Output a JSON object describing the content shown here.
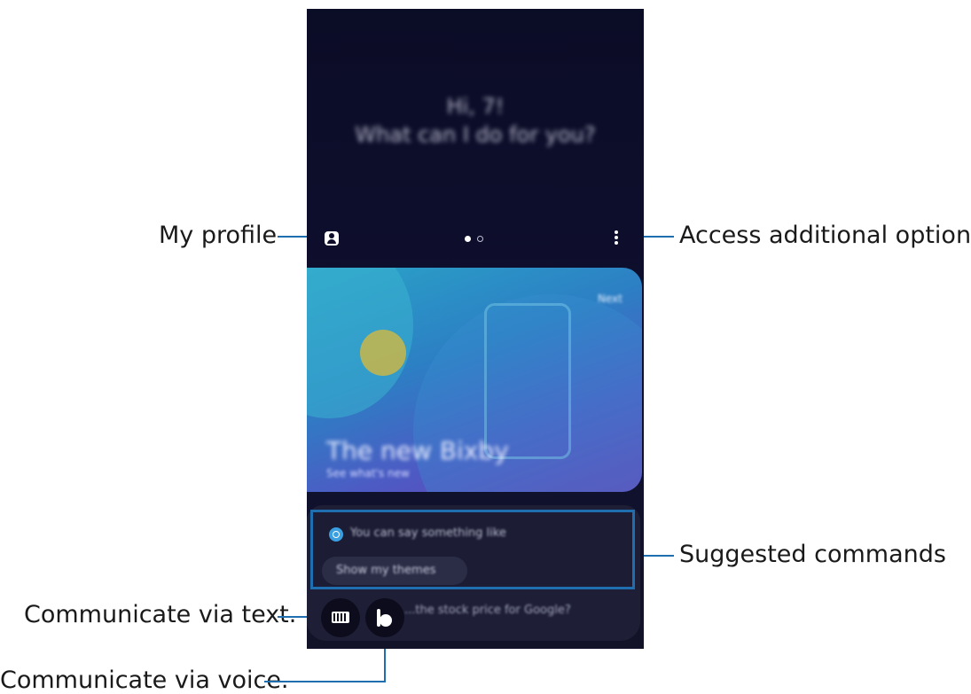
{
  "callouts": {
    "my_profile": "My profile",
    "access_options": "Access additional options.",
    "suggested": "Suggested commands",
    "via_text": "Communicate via text.",
    "via_voice": "Communicate via voice."
  },
  "screen": {
    "greeting_line1": "Hi, 7!",
    "greeting_line2": "What can I do for you?",
    "banner": {
      "title": "The new Bixby",
      "subtitle": "See what's new",
      "next": "Next"
    },
    "suggest": {
      "hint": "You can say something like",
      "chip": "Show my themes"
    },
    "bottom_hint": "...the stock price for Google?"
  },
  "colors": {
    "accent_line": "#1f6fb0",
    "screen_bg": "#0b0c26",
    "bubble_bg": "#1e1f36"
  }
}
